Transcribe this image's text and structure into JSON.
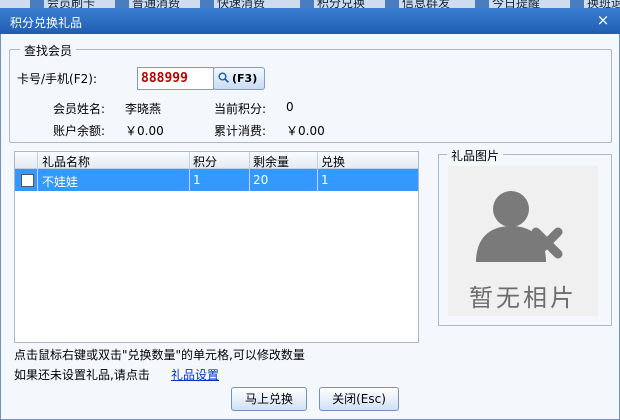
{
  "background_toolbar": {
    "items": [
      "会员刷卡",
      "普通消费",
      "快速消费",
      "积分兑换",
      "信息群发",
      "今日提醒",
      "换班退"
    ]
  },
  "window": {
    "title": "积分兑换礼品",
    "close_glyph": "×",
    "titlebar_color": "#2a6cc4"
  },
  "member_search": {
    "group_label": "查找会员",
    "card_label": "卡号/手机(F2):",
    "card_value": "888999",
    "search_button_label": "(F3)",
    "name_label": "会员姓名:",
    "name_value": "李晓燕",
    "points_label": "当前积分:",
    "points_value": "0",
    "balance_label": "账户余额:",
    "balance_value": "￥0.00",
    "total_spend_label": "累计消费:",
    "total_spend_value": "￥0.00"
  },
  "gift_table": {
    "columns": [
      "礼品名称",
      "积分",
      "剩余量",
      "兑换"
    ],
    "rows": [
      {
        "name": "不娃娃",
        "points": "1",
        "remaining": "20",
        "exchange": "1",
        "selected": true
      }
    ]
  },
  "gift_picture": {
    "group_label": "礼品图片",
    "placeholder_text": "暂无相片"
  },
  "hints": {
    "line1": "点击鼠标右键或双击\"兑换数量\"的单元格,可以修改数量",
    "line2_prefix": "如果还未设置礼品,请点击",
    "gift_settings_link": "礼品设置"
  },
  "buttons": {
    "redeem": "马上兑换",
    "close": "关闭(Esc)"
  }
}
